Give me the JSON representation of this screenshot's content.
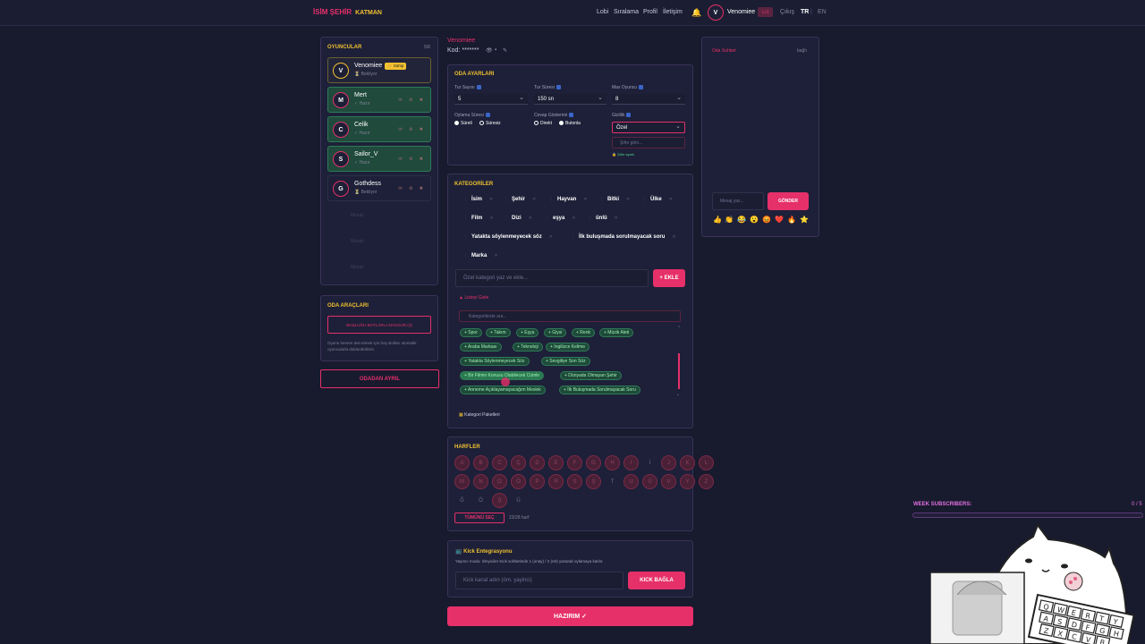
{
  "header": {
    "logo": "İSİM ŞEHİR",
    "logo_suffix": "KATMAN",
    "nav": [
      "Lobi",
      "Sıralama",
      "Profil",
      "İletişim"
    ],
    "user_initial": "V",
    "username": "Venomiee",
    "level": "Lv1",
    "logout": "Çıkış",
    "lang_active": "TR",
    "lang_other": "EN"
  },
  "players_panel": {
    "title": "OYUNCULAR",
    "count": "5/8",
    "players": [
      {
        "initial": "V",
        "name": "Venomiee",
        "badge": "👑 Sahip",
        "status": "⏳ Bekliyor"
      },
      {
        "initial": "M",
        "name": "Mert",
        "status": "✓ Hazır"
      },
      {
        "initial": "C",
        "name": "Celik",
        "status": "✓ Hazır"
      },
      {
        "initial": "S",
        "name": "Sailor_V",
        "status": "✓ Hazır"
      },
      {
        "initial": "G",
        "name": "Gothdess",
        "status": "⏳ Bekliyor"
      }
    ],
    "empty_slot": "Müsait"
  },
  "room_tools": {
    "title": "ODA ARAÇLARI",
    "fill_bots": "BOŞLUĞU BOTLARLA DOLDUR (3)",
    "hint": "Oyunu hemen test etmek için boş slotları otomatik oyuncularla doldurabilirsin.",
    "leave": "ODADAN AYRIL"
  },
  "room": {
    "owner": "Venomiee",
    "code_label": "Kod: *******"
  },
  "settings": {
    "title": "ODA AYARLARI",
    "round_count_label": "Tur Sayısı",
    "round_count": "5",
    "round_time_label": "Tur Süresi",
    "round_time": "150 sn",
    "max_players_label": "Max Oyuncu",
    "max_players": "8",
    "voting_label": "Oylama Süresi",
    "voting_options": [
      "Süreli",
      "Süresiz"
    ],
    "answers_label": "Cevap Gösterimi",
    "answers_options": [
      "Direkt",
      "Butonla"
    ],
    "privacy_label": "Gizlilik",
    "privacy": "Özel",
    "password_placeholder": "Şifre girin...",
    "password_hint": "🔒 Şifre ayarlı"
  },
  "categories": {
    "title": "KATEGORİLER",
    "items": [
      "İsim",
      "Şehir",
      "Hayvan",
      "Bitki",
      "Ülke",
      "Film",
      "Dizi",
      "eşya",
      "ünlü",
      "Yatakta söylenmeyecek söz",
      "İlk buluşmada sorulmayacak soru",
      "Marka"
    ],
    "custom_placeholder": "Özel kategori yaz ve ekle...",
    "add_button": "+ EKLE",
    "list_toggle": "▲ Listeyi Gizle",
    "search_placeholder": "Kategorilerde ara...",
    "suggestions": [
      "+ Spor",
      "+ Takım",
      "+ Eşya",
      "+ Giysi",
      "+ Renk",
      "+ Müzik Aleti",
      "+ Araba Markası",
      "+ Teknoloji",
      "+ İngilizce Kelime",
      "+ Yatakta Söylenmeyecek Söz",
      "+ Sevgiliye Son Söz",
      "+ Bir Filmin Konusu Olabilecek Cümle",
      "+ Dünyada Olmayan Şehir",
      "+ Anneme Açıklayamayacağım Meslek",
      "+ İlk Buluşmada Sorulmayacak Soru"
    ],
    "packages": "Kategori Paketleri"
  },
  "letters": {
    "title": "HARFLER",
    "row1": [
      "A",
      "B",
      "C",
      "Ç",
      "D",
      "E",
      "F",
      "G",
      "H",
      "I",
      "İ",
      "J",
      "K",
      "L"
    ],
    "row2": [
      "M",
      "N",
      "O",
      "Ö",
      "P",
      "R",
      "S",
      "Ş",
      "T",
      "U",
      "Ü",
      "V",
      "Y",
      "Z"
    ],
    "row3": [
      "Ğ",
      "Ö",
      "Ş",
      "Ü"
    ],
    "select_all": "TÜMÜNÜ SEÇ",
    "count": "23/28 harf"
  },
  "kick": {
    "title": "Kick Entegrasyonu",
    "desc": "Yayıncı modu: İzleyiciler Kick sohbetinde 1 (onay) / 2 (ret) yazarak oylamaya katılır.",
    "placeholder": "Kick kanal adın (örn. yayinci)",
    "button": "KICK BAĞLA"
  },
  "ready_button": "HAZIRIM ✓",
  "chat": {
    "title": "Oda Sohbet",
    "status": "bağlı",
    "placeholder": "Mesaj yaz...",
    "send": "GÖNDER",
    "emojis": [
      "👍",
      "👏",
      "😂",
      "😮",
      "😡",
      "❤️",
      "🔥",
      "💯",
      "⭐"
    ]
  },
  "overlay": {
    "subscribers_label": "WEEK SUBSCRIBERS:",
    "subscribers_count": "0 / 5",
    "keyboard_keys": [
      "Q",
      "W",
      "E",
      "R",
      "T",
      "Y",
      "A",
      "S",
      "D",
      "F",
      "G",
      "H",
      "Z",
      "X",
      "C",
      "V",
      "B"
    ]
  },
  "colors": {
    "accent": "#e6306a",
    "gold": "#f0c030",
    "bg": "#181a2e",
    "panel": "#1d2038",
    "ready": "#1e4a3a"
  }
}
